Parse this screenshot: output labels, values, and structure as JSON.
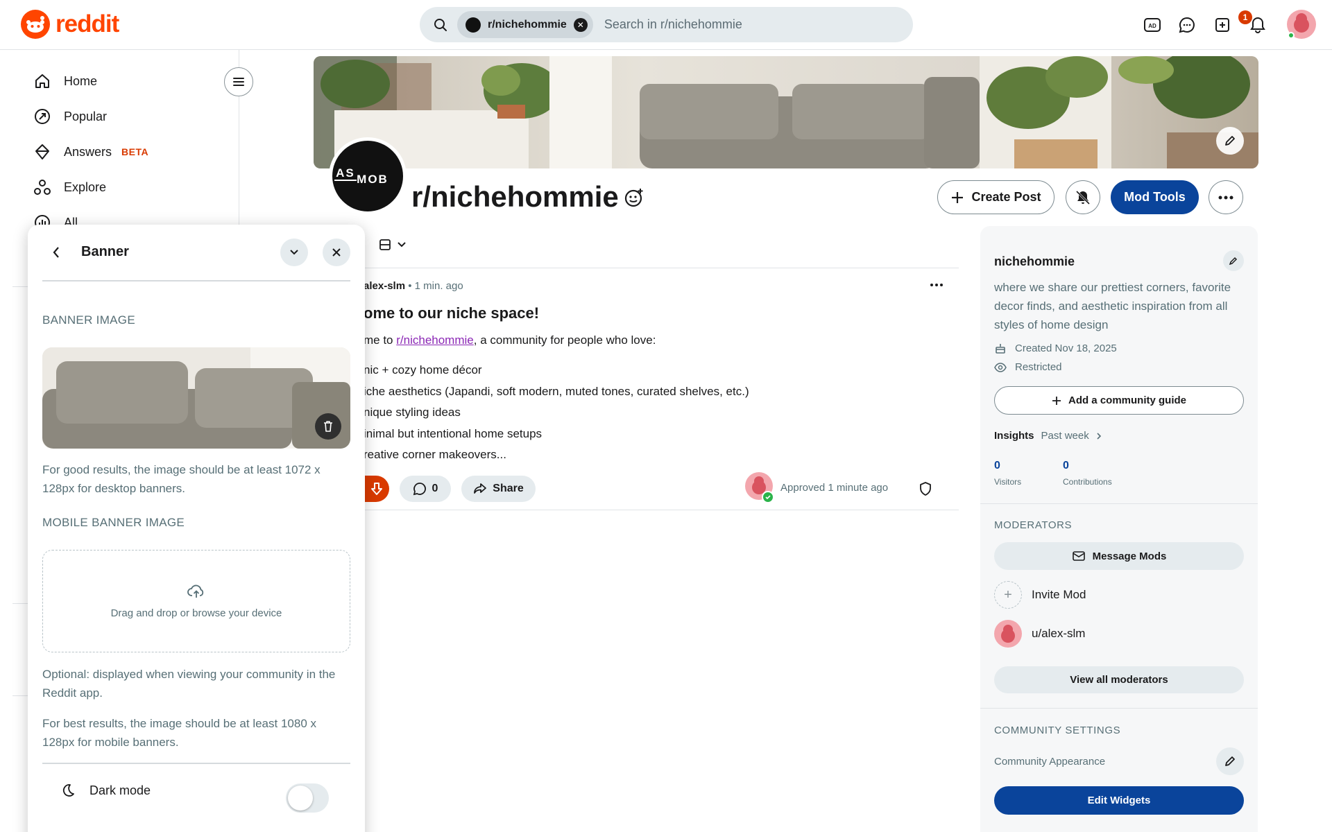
{
  "header": {
    "logo_text": "reddit",
    "search_chip": "r/nichehommie",
    "search_placeholder": "Search in r/nichehommie",
    "notification_count": "1",
    "icons": [
      "advertise-icon",
      "chat-icon",
      "create-icon",
      "notification-icon",
      "user-avatar"
    ]
  },
  "nav": {
    "items": [
      {
        "label": "Home",
        "icon": "home-icon"
      },
      {
        "label": "Popular",
        "icon": "popular-icon"
      },
      {
        "label": "Answers",
        "badge": "BETA",
        "icon": "answers-icon"
      },
      {
        "label": "Explore",
        "icon": "explore-icon"
      },
      {
        "label": "All",
        "icon": "all-icon"
      }
    ]
  },
  "panel": {
    "title": "Banner",
    "banner_section": "BANNER IMAGE",
    "banner_hint": "For good results, the image should be at least 1072 x 128px for desktop banners.",
    "mobile_section": "MOBILE BANNER IMAGE",
    "dropzone_text": "Drag and drop or browse your device",
    "mobile_optional": "Optional: displayed when viewing your community in the Reddit app.",
    "mobile_hint": "For best results, the image should be at least 1080 x 128px for mobile banners.",
    "dark_mode_label": "Dark mode",
    "dark_mode_on": false
  },
  "community": {
    "name": "r/nichehommie",
    "avatar_text_top": "AS",
    "avatar_text_bottom": "MOB",
    "create_post": "Create Post",
    "mod_tools": "Mod Tools"
  },
  "post": {
    "author": "alex-slm",
    "age": "1 min. ago",
    "title": "ome to our niche space!",
    "intro_before": "me to ",
    "intro_link": "r/nichehommie",
    "intro_after": ", a community for people who love:",
    "bullets": [
      "nic + cozy home décor",
      "iche aesthetics (Japandi, soft modern, muted tones, curated shelves, etc.)",
      "nique styling ideas",
      "inimal but intentional home setups",
      "reative corner makeovers..."
    ],
    "comments": "0",
    "share": "Share",
    "approved": "Approved 1 minute ago"
  },
  "sidebar": {
    "name": "nichehommie",
    "description": "where we share our prettiest corners, favorite decor finds, and aesthetic inspiration from all styles of home design",
    "created": "Created Nov 18, 2025",
    "privacy": "Restricted",
    "guide_button": "Add a community guide",
    "insights_label": "Insights",
    "insights_range": "Past week",
    "visitors_value": "0",
    "visitors_label": "Visitors",
    "contributions_value": "0",
    "contributions_label": "Contributions",
    "moderators_heading": "MODERATORS",
    "message_mods": "Message Mods",
    "invite_mod": "Invite Mod",
    "moderator": "u/alex-slm",
    "view_all": "View all moderators",
    "settings_heading": "COMMUNITY SETTINGS",
    "appearance": "Community Appearance",
    "edit_widgets": "Edit Widgets"
  },
  "colors": {
    "brand": "#ff4500",
    "mod_blue": "#0a449b",
    "link_purple": "#8b27b5",
    "downvote": "#d93a00"
  }
}
